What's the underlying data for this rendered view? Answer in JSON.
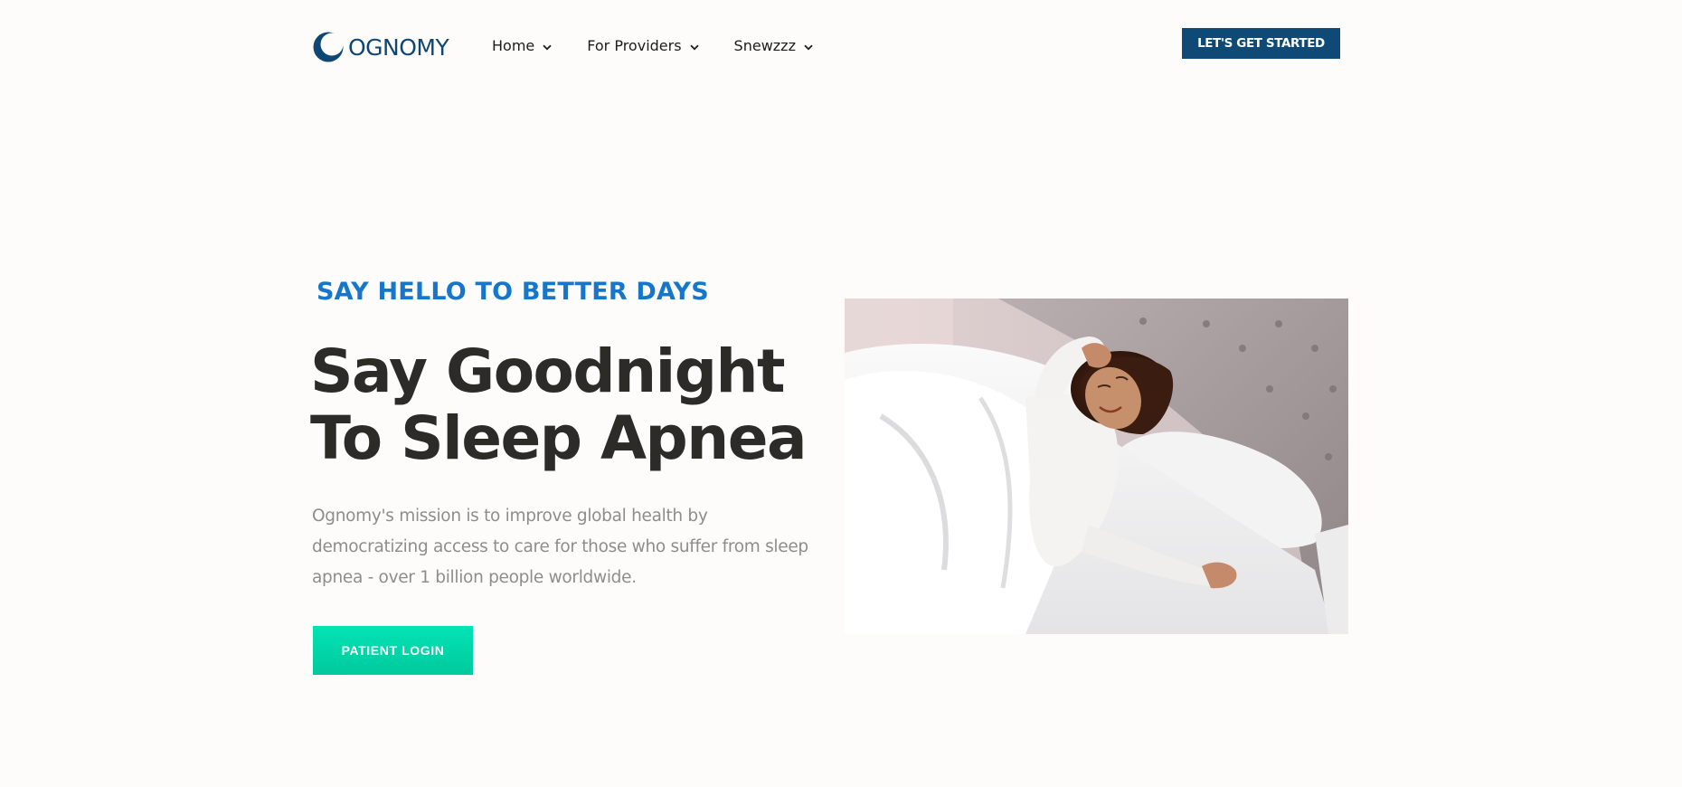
{
  "brand": {
    "logo_text": "OGNOMY",
    "primary_color": "#0e4a75",
    "accent_color": "#1576cc",
    "cta_color": "#00d9ab"
  },
  "nav": {
    "items": [
      {
        "label": "Home",
        "icon": "chevron-down-icon"
      },
      {
        "label": "For Providers",
        "icon": "chevron-down-icon"
      },
      {
        "label": "Snewzzz",
        "icon": "chevron-down-icon"
      }
    ],
    "cta_label": "LET'S GET STARTED"
  },
  "hero": {
    "eyebrow": "SAY HELLO TO BETTER DAYS",
    "headline_line1": "Say Goodnight",
    "headline_line2": "To Sleep Apnea",
    "mission_text": "Ognomy's mission is to improve global health by democratizing access to care for those who suffer from sleep apnea - over 1 billion people worldwide.",
    "button_label": "PATIENT LOGIN",
    "image_subject": "woman waking up stretching in bed"
  }
}
